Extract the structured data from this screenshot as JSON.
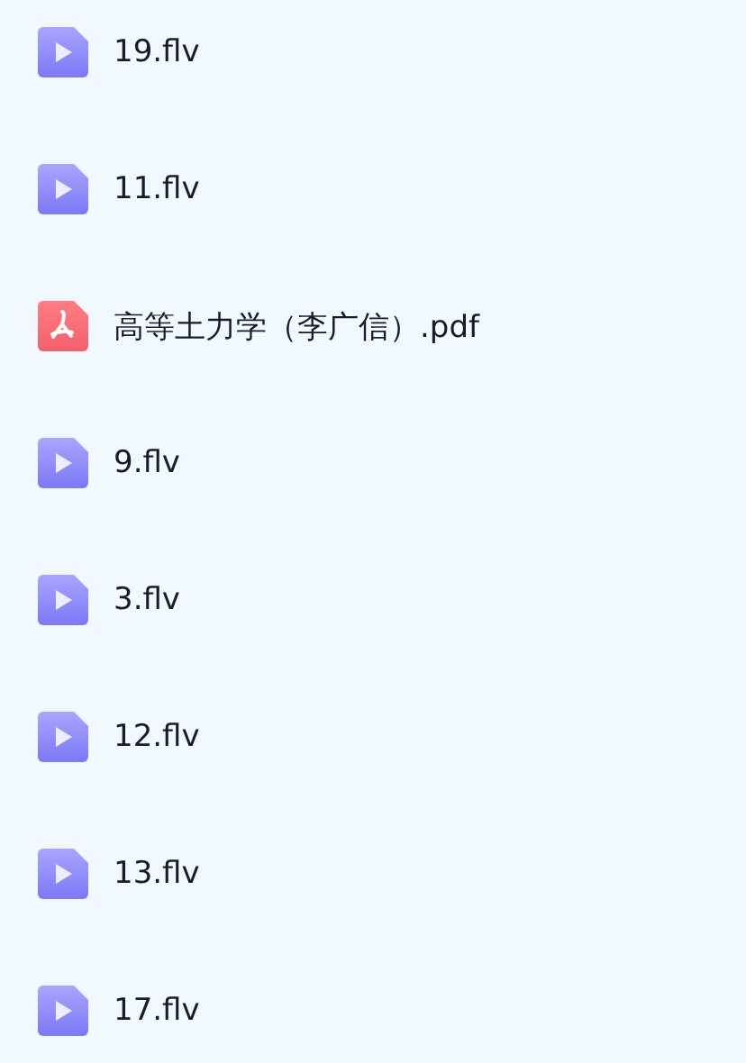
{
  "files": [
    {
      "name": "19.flv",
      "kind": "video"
    },
    {
      "name": "11.flv",
      "kind": "video"
    },
    {
      "name": "高等土力学（李广信）.pdf",
      "kind": "pdf"
    },
    {
      "name": "9.flv",
      "kind": "video"
    },
    {
      "name": "3.flv",
      "kind": "video"
    },
    {
      "name": "12.flv",
      "kind": "video"
    },
    {
      "name": "13.flv",
      "kind": "video"
    },
    {
      "name": "17.flv",
      "kind": "video"
    }
  ]
}
